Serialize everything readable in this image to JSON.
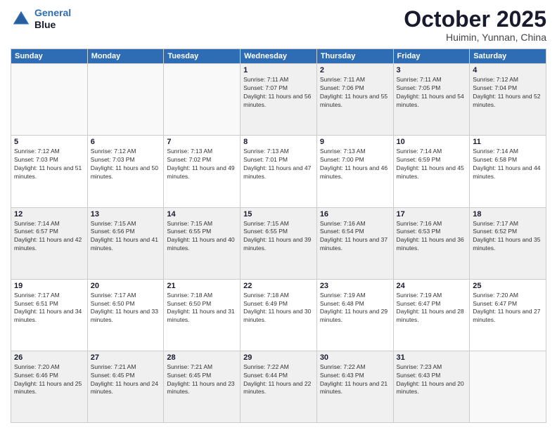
{
  "header": {
    "logo_line1": "General",
    "logo_line2": "Blue",
    "month": "October 2025",
    "location": "Huimin, Yunnan, China"
  },
  "days_of_week": [
    "Sunday",
    "Monday",
    "Tuesday",
    "Wednesday",
    "Thursday",
    "Friday",
    "Saturday"
  ],
  "weeks": [
    [
      {
        "day": "",
        "info": ""
      },
      {
        "day": "",
        "info": ""
      },
      {
        "day": "",
        "info": ""
      },
      {
        "day": "1",
        "info": "Sunrise: 7:11 AM\nSunset: 7:07 PM\nDaylight: 11 hours and 56 minutes."
      },
      {
        "day": "2",
        "info": "Sunrise: 7:11 AM\nSunset: 7:06 PM\nDaylight: 11 hours and 55 minutes."
      },
      {
        "day": "3",
        "info": "Sunrise: 7:11 AM\nSunset: 7:05 PM\nDaylight: 11 hours and 54 minutes."
      },
      {
        "day": "4",
        "info": "Sunrise: 7:12 AM\nSunset: 7:04 PM\nDaylight: 11 hours and 52 minutes."
      }
    ],
    [
      {
        "day": "5",
        "info": "Sunrise: 7:12 AM\nSunset: 7:03 PM\nDaylight: 11 hours and 51 minutes."
      },
      {
        "day": "6",
        "info": "Sunrise: 7:12 AM\nSunset: 7:03 PM\nDaylight: 11 hours and 50 minutes."
      },
      {
        "day": "7",
        "info": "Sunrise: 7:13 AM\nSunset: 7:02 PM\nDaylight: 11 hours and 49 minutes."
      },
      {
        "day": "8",
        "info": "Sunrise: 7:13 AM\nSunset: 7:01 PM\nDaylight: 11 hours and 47 minutes."
      },
      {
        "day": "9",
        "info": "Sunrise: 7:13 AM\nSunset: 7:00 PM\nDaylight: 11 hours and 46 minutes."
      },
      {
        "day": "10",
        "info": "Sunrise: 7:14 AM\nSunset: 6:59 PM\nDaylight: 11 hours and 45 minutes."
      },
      {
        "day": "11",
        "info": "Sunrise: 7:14 AM\nSunset: 6:58 PM\nDaylight: 11 hours and 44 minutes."
      }
    ],
    [
      {
        "day": "12",
        "info": "Sunrise: 7:14 AM\nSunset: 6:57 PM\nDaylight: 11 hours and 42 minutes."
      },
      {
        "day": "13",
        "info": "Sunrise: 7:15 AM\nSunset: 6:56 PM\nDaylight: 11 hours and 41 minutes."
      },
      {
        "day": "14",
        "info": "Sunrise: 7:15 AM\nSunset: 6:55 PM\nDaylight: 11 hours and 40 minutes."
      },
      {
        "day": "15",
        "info": "Sunrise: 7:15 AM\nSunset: 6:55 PM\nDaylight: 11 hours and 39 minutes."
      },
      {
        "day": "16",
        "info": "Sunrise: 7:16 AM\nSunset: 6:54 PM\nDaylight: 11 hours and 37 minutes."
      },
      {
        "day": "17",
        "info": "Sunrise: 7:16 AM\nSunset: 6:53 PM\nDaylight: 11 hours and 36 minutes."
      },
      {
        "day": "18",
        "info": "Sunrise: 7:17 AM\nSunset: 6:52 PM\nDaylight: 11 hours and 35 minutes."
      }
    ],
    [
      {
        "day": "19",
        "info": "Sunrise: 7:17 AM\nSunset: 6:51 PM\nDaylight: 11 hours and 34 minutes."
      },
      {
        "day": "20",
        "info": "Sunrise: 7:17 AM\nSunset: 6:50 PM\nDaylight: 11 hours and 33 minutes."
      },
      {
        "day": "21",
        "info": "Sunrise: 7:18 AM\nSunset: 6:50 PM\nDaylight: 11 hours and 31 minutes."
      },
      {
        "day": "22",
        "info": "Sunrise: 7:18 AM\nSunset: 6:49 PM\nDaylight: 11 hours and 30 minutes."
      },
      {
        "day": "23",
        "info": "Sunrise: 7:19 AM\nSunset: 6:48 PM\nDaylight: 11 hours and 29 minutes."
      },
      {
        "day": "24",
        "info": "Sunrise: 7:19 AM\nSunset: 6:47 PM\nDaylight: 11 hours and 28 minutes."
      },
      {
        "day": "25",
        "info": "Sunrise: 7:20 AM\nSunset: 6:47 PM\nDaylight: 11 hours and 27 minutes."
      }
    ],
    [
      {
        "day": "26",
        "info": "Sunrise: 7:20 AM\nSunset: 6:46 PM\nDaylight: 11 hours and 25 minutes."
      },
      {
        "day": "27",
        "info": "Sunrise: 7:21 AM\nSunset: 6:45 PM\nDaylight: 11 hours and 24 minutes."
      },
      {
        "day": "28",
        "info": "Sunrise: 7:21 AM\nSunset: 6:45 PM\nDaylight: 11 hours and 23 minutes."
      },
      {
        "day": "29",
        "info": "Sunrise: 7:22 AM\nSunset: 6:44 PM\nDaylight: 11 hours and 22 minutes."
      },
      {
        "day": "30",
        "info": "Sunrise: 7:22 AM\nSunset: 6:43 PM\nDaylight: 11 hours and 21 minutes."
      },
      {
        "day": "31",
        "info": "Sunrise: 7:23 AM\nSunset: 6:43 PM\nDaylight: 11 hours and 20 minutes."
      },
      {
        "day": "",
        "info": ""
      }
    ]
  ]
}
